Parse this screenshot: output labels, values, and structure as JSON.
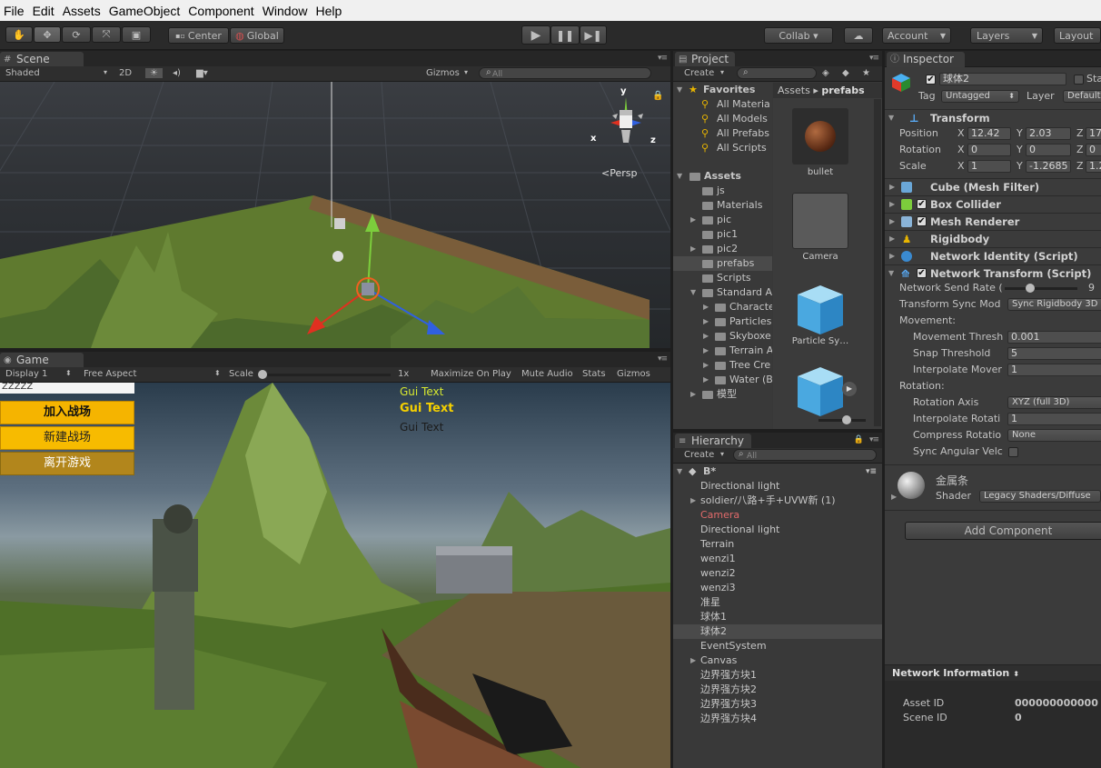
{
  "menu": [
    "File",
    "Edit",
    "Assets",
    "GameObject",
    "Component",
    "Window",
    "Help"
  ],
  "toolbar": {
    "pivot": "Center",
    "space": "Global",
    "collab": "Collab ▾",
    "account": "Account",
    "layers": "Layers",
    "layout": "Layout"
  },
  "scene": {
    "tab": "Scene",
    "shading": "Shaded",
    "mode_2d": "2D",
    "gizmos": "Gizmos",
    "search_placeholder": "All",
    "persp": "Persp",
    "axes": {
      "y": "y",
      "x": "x",
      "z": "z"
    }
  },
  "game": {
    "tab": "Game",
    "display": "Display 1",
    "aspect": "Free Aspect",
    "scale_label": "Scale",
    "scale_value": "1x",
    "maximize": "Maximize On Play",
    "mute": "Mute Audio",
    "stats": "Stats",
    "gizmos": "Gizmos",
    "input_text": "ZZZZZ",
    "buttons": [
      "加入战场",
      "新建战场",
      "离开游戏"
    ],
    "gui_texts": [
      "Gui Text",
      "Gui Text",
      "Gui Text"
    ]
  },
  "project": {
    "tab": "Project",
    "create": "Create",
    "favorites_label": "Favorites",
    "favorites": [
      "All Materia",
      "All Models",
      "All Prefabs",
      "All Scripts"
    ],
    "assets_label": "Assets",
    "folders": [
      {
        "name": "js",
        "exp": false
      },
      {
        "name": "Materials",
        "exp": false
      },
      {
        "name": "pic",
        "exp": true
      },
      {
        "name": "pic1",
        "exp": false
      },
      {
        "name": "pic2",
        "exp": true
      },
      {
        "name": "prefabs",
        "exp": false,
        "sel": true
      },
      {
        "name": "Scripts",
        "exp": false
      },
      {
        "name": "Standard A",
        "exp": true,
        "open": true
      }
    ],
    "standard_children": [
      "Characte",
      "Particles",
      "Skyboxe",
      "Terrain A",
      "Tree Cre",
      "Water (B"
    ],
    "model_folder": "模型",
    "breadcrumb": {
      "root": "Assets",
      "sep": "▸",
      "current": "prefabs"
    },
    "items": [
      "bullet",
      "Camera",
      "Particle Sy…",
      ""
    ]
  },
  "hierarchy": {
    "tab": "Hierarchy",
    "create": "Create",
    "search_placeholder": "All",
    "scene": "B*",
    "items": [
      {
        "name": "Directional light",
        "exp": false
      },
      {
        "name": "soldier/八路+手+UVW新 (1)",
        "exp": true
      },
      {
        "name": "Camera",
        "exp": false,
        "red": true
      },
      {
        "name": "Directional light",
        "exp": false
      },
      {
        "name": "Terrain",
        "exp": false
      },
      {
        "name": "wenzi1",
        "exp": false
      },
      {
        "name": "wenzi2",
        "exp": false
      },
      {
        "name": "wenzi3",
        "exp": false
      },
      {
        "name": "准星",
        "exp": false
      },
      {
        "name": "球体1",
        "exp": false
      },
      {
        "name": "球体2",
        "exp": false,
        "sel": true
      },
      {
        "name": "EventSystem",
        "exp": false
      },
      {
        "name": "Canvas",
        "exp": true
      },
      {
        "name": "边界强方块1",
        "exp": false
      },
      {
        "name": "边界强方块2",
        "exp": false
      },
      {
        "name": "边界强方块3",
        "exp": false
      },
      {
        "name": "边界强方块4",
        "exp": false
      }
    ]
  },
  "inspector": {
    "tab": "Inspector",
    "name": "球体2",
    "static": "Sta",
    "tag_label": "Tag",
    "tag": "Untagged",
    "layer_label": "Layer",
    "layer": "Default",
    "transform_label": "Transform",
    "position": {
      "label": "Position",
      "x": "12.42",
      "y": "2.03",
      "z": "17"
    },
    "rotation": {
      "label": "Rotation",
      "x": "0",
      "y": "0",
      "z": "0"
    },
    "scale": {
      "label": "Scale",
      "x": "1",
      "y": "-1.2685",
      "z": "1.2"
    },
    "components": [
      "Cube (Mesh Filter)",
      "Box Collider",
      "Mesh Renderer",
      "Rigidbody",
      "Network Identity (Script)",
      "Network Transform (Script)"
    ],
    "nt": {
      "send_rate_label": "Network Send Rate (",
      "send_rate": "9",
      "sync_mode_label": "Transform Sync Mod",
      "sync_mode": "Sync Rigidbody 3D",
      "movement_label": "Movement:",
      "move_thresh_label": "Movement Thresh",
      "move_thresh": "0.001",
      "snap_label": "Snap Threshold",
      "snap": "5",
      "interp_move_label": "Interpolate Mover",
      "interp_move": "1",
      "rotation_label": "Rotation:",
      "rot_axis_label": "Rotation Axis",
      "rot_axis": "XYZ (full 3D)",
      "interp_rot_label": "Interpolate Rotati",
      "interp_rot": "1",
      "compress_label": "Compress Rotatio",
      "compress": "None",
      "sync_ang_label": "Sync Angular Velc"
    },
    "material": "金属条",
    "shader_label": "Shader",
    "shader": "Legacy Shaders/Diffuse",
    "add_component": "Add Component",
    "net_info": "Network Information",
    "asset_id_label": "Asset ID",
    "asset_id": "000000000000",
    "scene_id_label": "Scene ID",
    "scene_id": "0"
  }
}
